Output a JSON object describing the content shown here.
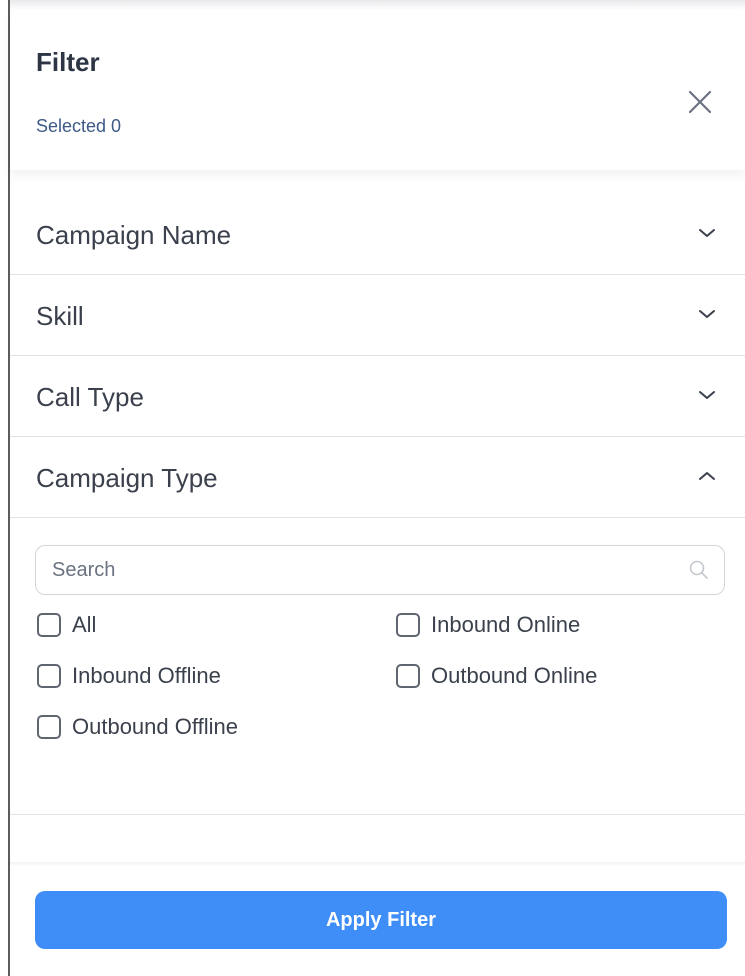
{
  "header": {
    "title": "Filter",
    "selected_text": "Selected 0",
    "close_icon": "close-icon"
  },
  "sections": [
    {
      "label": "Campaign Name",
      "expanded": false,
      "icon": "chevron-down-icon"
    },
    {
      "label": "Skill",
      "expanded": false,
      "icon": "chevron-down-icon"
    },
    {
      "label": "Call Type",
      "expanded": false,
      "icon": "chevron-down-icon"
    },
    {
      "label": "Campaign Type",
      "expanded": true,
      "icon": "chevron-up-icon"
    }
  ],
  "campaign_type": {
    "search": {
      "placeholder": "Search",
      "value": "",
      "icon": "search-icon"
    },
    "options": [
      {
        "label": "All",
        "checked": false
      },
      {
        "label": "Inbound Online",
        "checked": false
      },
      {
        "label": "Inbound Offline",
        "checked": false
      },
      {
        "label": "Outbound Online",
        "checked": false
      },
      {
        "label": "Outbound Offline",
        "checked": false
      }
    ]
  },
  "footer": {
    "apply_label": "Apply Filter"
  },
  "colors": {
    "accent": "#3f8ef7",
    "title_text": "#2d3544",
    "selected_text": "#3d5a86",
    "body_text": "#3b414c",
    "divider": "#dfe2e6"
  }
}
